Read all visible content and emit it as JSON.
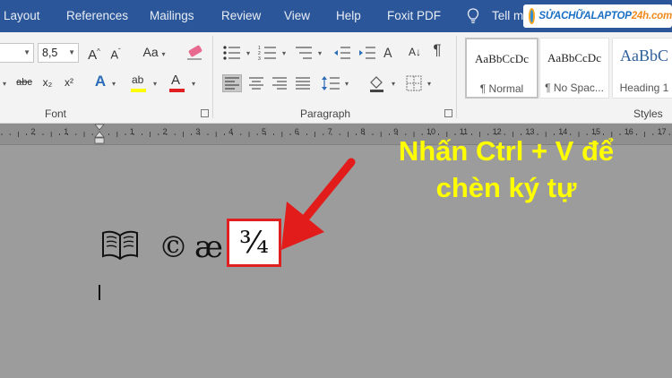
{
  "tabs": [
    "Layout",
    "References",
    "Mailings",
    "Review",
    "View",
    "Help",
    "Foxit PDF"
  ],
  "tell_me": "Tell m",
  "logo": {
    "prefix": "SỬACHỮALAPTOP",
    "suffix": "24h.com"
  },
  "font_group": {
    "font_size": "8,5",
    "grow_label": "A",
    "shrink_label": "A",
    "change_case_label": "Aa",
    "strike_label": "abc",
    "subscript_label": "x₂",
    "superscript_label": "x²",
    "effects_label": "A",
    "highlight_label": "ab",
    "font_color_label": "A",
    "label": "Font"
  },
  "paragraph_group": {
    "label": "Paragraph",
    "pilcrow": "¶"
  },
  "styles_group": {
    "label": "Styles",
    "items": [
      {
        "sample": "AaBbCcDc",
        "name": "¶ Normal"
      },
      {
        "sample": "AaBbCcDc",
        "name": "¶ No Spac..."
      },
      {
        "sample": "AaBbC",
        "name": "Heading 1"
      }
    ]
  },
  "ruler_numbers": [
    "2",
    "1",
    "1",
    "2",
    "3",
    "4",
    "5",
    "6",
    "7",
    "8",
    "9",
    "10",
    "11",
    "12",
    "13",
    "14",
    "15",
    "16",
    "17"
  ],
  "document": {
    "symbols": [
      "📖",
      "©",
      "æ"
    ],
    "fraction": "¾"
  },
  "callout": {
    "line1": "Nhấn Ctrl + V để",
    "line2": "chèn ký tự"
  },
  "colors": {
    "tab_bar": "#2b579a",
    "callout_text": "#ffff00",
    "highlight_box": "#e02020",
    "arrow": "#e21b1b"
  }
}
